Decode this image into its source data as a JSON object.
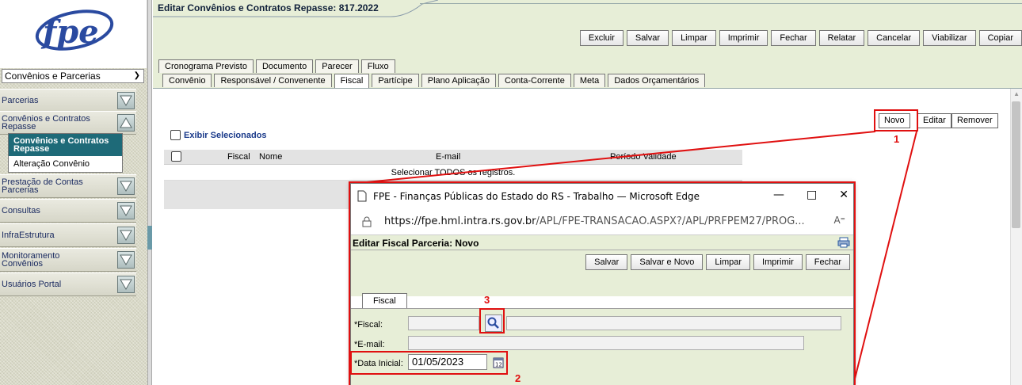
{
  "app": {
    "logo_text": "fpe",
    "module_select": "Convênios e Parcerias"
  },
  "sidebar": {
    "items": [
      {
        "label": "Parcerias"
      },
      {
        "label": "Convênios e Contratos Repasse"
      },
      {
        "label": "Prestação de Contas Parcerias"
      },
      {
        "label": "Consultas"
      },
      {
        "label": "InfraEstrutura"
      },
      {
        "label": "Monitoramento Convênios"
      },
      {
        "label": "Usuários Portal"
      }
    ],
    "submenu": [
      {
        "label": "Convênios e Contratos Repasse",
        "active": true
      },
      {
        "label": "Alteração Convênio",
        "active": false
      }
    ]
  },
  "page": {
    "title": "Editar Convênios e Contratos Repasse: 817.2022",
    "toolbar": [
      "Excluir",
      "Salvar",
      "Limpar",
      "Imprimir",
      "Fechar",
      "Relatar",
      "Cancelar",
      "Viabilizar",
      "Copiar"
    ],
    "tabs_row1": [
      "Cronograma Previsto",
      "Documento",
      "Parecer",
      "Fluxo"
    ],
    "tabs_row2": [
      "Convênio",
      "Responsável / Convenente",
      "Fiscal",
      "Partícipe",
      "Plano Aplicação",
      "Conta-Corrente",
      "Meta",
      "Dados Orçamentários"
    ],
    "active_tab": "Fiscal",
    "actions": {
      "novo": "Novo",
      "editar": "Editar",
      "remover": "Remover"
    },
    "exibir_label": "Exibir Selecionados",
    "grid": {
      "columns": [
        "Fiscal",
        "Nome",
        "E-mail",
        "Período Validade"
      ],
      "select_all_text": "Selecionar TODOS os registros."
    }
  },
  "annotations": [
    "1",
    "2",
    "3"
  ],
  "popup": {
    "window_title": "FPE - Finanças Públicas do Estado do RS - Trabalho — Microsoft Edge",
    "url_host": "https://fpe.hml.intra.rs.gov.br",
    "url_path": "/APL/FPE-TRANSACAO.ASPX?/APL/PRFPEM27/PROG...",
    "header": "Editar Fiscal Parceria: Novo",
    "toolbar": [
      "Salvar",
      "Salvar e Novo",
      "Limpar",
      "Imprimir",
      "Fechar"
    ],
    "tab": "Fiscal",
    "fields": {
      "fiscal_label": "*Fiscal:",
      "email_label": "*E-mail:",
      "data_label": "*Data Inicial:",
      "data_value": "01/05/2023"
    }
  },
  "colors": {
    "accent": "#1e6a78",
    "header_bg": "#e7eed7",
    "annotation": "#e01010"
  }
}
